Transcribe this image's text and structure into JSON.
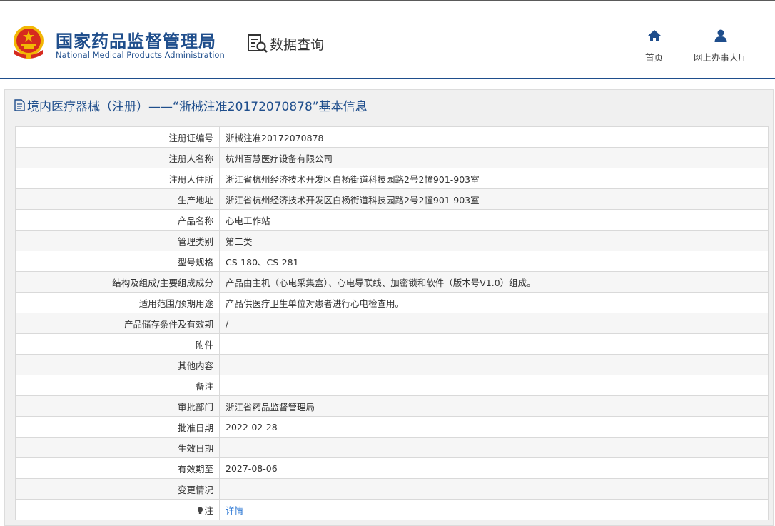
{
  "header": {
    "org_name_cn": "国家药品监督管理局",
    "org_name_en": "National Medical Products Administration",
    "section_title": "数据查询",
    "nav": [
      {
        "label": "首页",
        "icon": "home-icon"
      },
      {
        "label": "网上办事大厅",
        "icon": "user-icon"
      }
    ]
  },
  "panel": {
    "title": "境内医疗器械（注册）——“浙械注准20172070878”基本信息",
    "rows": [
      {
        "label": "注册证编号",
        "value": "浙械注准20172070878"
      },
      {
        "label": "注册人名称",
        "value": "杭州百慧医疗设备有限公司"
      },
      {
        "label": "注册人住所",
        "value": "浙江省杭州经济技术开发区白杨街道科技园路2号2幢901-903室"
      },
      {
        "label": "生产地址",
        "value": "浙江省杭州经济技术开发区白杨街道科技园路2号2幢901-903室"
      },
      {
        "label": "产品名称",
        "value": "心电工作站"
      },
      {
        "label": "管理类别",
        "value": "第二类"
      },
      {
        "label": "型号规格",
        "value": " CS-180、CS-281"
      },
      {
        "label": "结构及组成/主要组成成分",
        "value": "产品由主机（心电采集盒）、心电导联线、加密锁和软件（版本号V1.0）组成。"
      },
      {
        "label": "适用范围/预期用途",
        "value": "产品供医疗卫生单位对患者进行心电检查用。"
      },
      {
        "label": "产品储存条件及有效期",
        "value": "/"
      },
      {
        "label": "附件",
        "value": ""
      },
      {
        "label": "其他内容",
        "value": ""
      },
      {
        "label": "备注",
        "value": ""
      },
      {
        "label": "审批部门",
        "value": "浙江省药品监督管理局"
      },
      {
        "label": "批准日期",
        "value": "2022-02-28"
      },
      {
        "label": "生效日期",
        "value": ""
      },
      {
        "label": "有效期至",
        "value": "2027-08-06"
      },
      {
        "label": "变更情况",
        "value": ""
      }
    ],
    "note_row": {
      "label": "注",
      "link_text": "详情"
    }
  },
  "colors": {
    "brand_blue": "#1f4e8c",
    "link_blue": "#1f6fd1",
    "emblem_red": "#d62a1e",
    "emblem_gold": "#f2b705"
  }
}
